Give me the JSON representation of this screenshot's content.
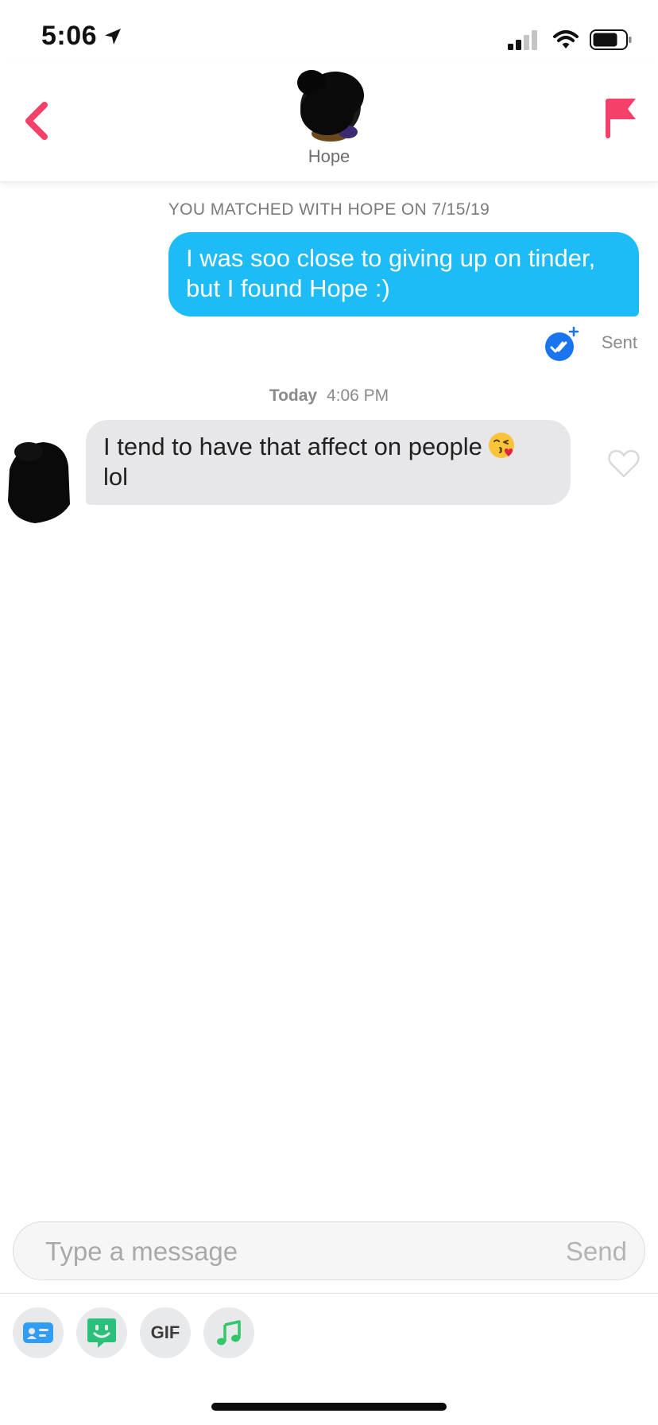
{
  "status_bar": {
    "time": "5:06",
    "icons": [
      "location-arrow-icon",
      "cellular-signal-icon",
      "wifi-icon",
      "battery-icon"
    ]
  },
  "header": {
    "contact_name": "Hope",
    "back_icon": "chevron-left-icon",
    "report_icon": "flag-icon",
    "accent_color": "#f5406a"
  },
  "conversation": {
    "match_banner": "YOU MATCHED WITH HOPE ON 7/15/19",
    "sent_message": {
      "text": "I was soo close to giving up on tinder, but I found Hope :)",
      "status": "Sent",
      "receipt_icon": "double-check-plus-icon",
      "bubble_color": "#1ebcf6"
    },
    "timestamp": {
      "day": "Today",
      "time": "4:06 PM"
    },
    "received_message": {
      "text": "I tend to have that affect on people",
      "emoji": "face-blowing-a-kiss-emoji",
      "text_after_emoji": "lol",
      "bubble_color": "#e7e7e9",
      "like_icon": "heart-outline-icon"
    }
  },
  "composer": {
    "placeholder": "Type a message",
    "value": "",
    "send_label": "Send"
  },
  "toolbar": {
    "buttons": [
      {
        "icon": "contact-card-icon",
        "color": "#2f9df4"
      },
      {
        "icon": "sticker-face-icon",
        "color": "#2bbf7c"
      },
      {
        "icon": "gif-icon",
        "label": "GIF"
      },
      {
        "icon": "music-note-icon",
        "color": "#32c86a"
      }
    ]
  }
}
